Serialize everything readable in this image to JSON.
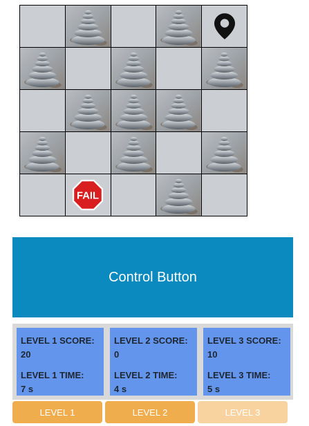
{
  "grid": {
    "rows": [
      [
        "empty",
        "stone",
        "empty",
        "stone",
        "marker"
      ],
      [
        "stone",
        "empty",
        "stone",
        "empty",
        "stone"
      ],
      [
        "empty",
        "stone",
        "stone",
        "stone",
        "empty"
      ],
      [
        "stone",
        "empty",
        "stone",
        "empty",
        "stone"
      ],
      [
        "empty",
        "fail",
        "empty",
        "stone",
        "empty"
      ]
    ],
    "fail_label": "FAIL",
    "colors": {
      "empty": "#cbced3",
      "fail_red": "#d81e1e",
      "marker": "#111111"
    }
  },
  "control": {
    "label": "Control Button",
    "color": "#0a8abf"
  },
  "scores": [
    {
      "score_label": "LEVEL 1 SCORE:",
      "score": "20",
      "time_label": "LEVEL 1 TIME:",
      "time": "7 s"
    },
    {
      "score_label": "LEVEL 2 SCORE:",
      "score": "0",
      "time_label": "LEVEL 2 TIME:",
      "time": "4 s"
    },
    {
      "score_label": "LEVEL 3 SCORE:",
      "score": "10",
      "time_label": "LEVEL 3 TIME:",
      "time": "5 s"
    }
  ],
  "levels": [
    {
      "label": "LEVEL 1",
      "color": "#f0ad4e",
      "active": true
    },
    {
      "label": "LEVEL 2",
      "color": "#f0ad4e",
      "active": true
    },
    {
      "label": "LEVEL 3",
      "color": "#f8d3a0",
      "active": false
    }
  ]
}
